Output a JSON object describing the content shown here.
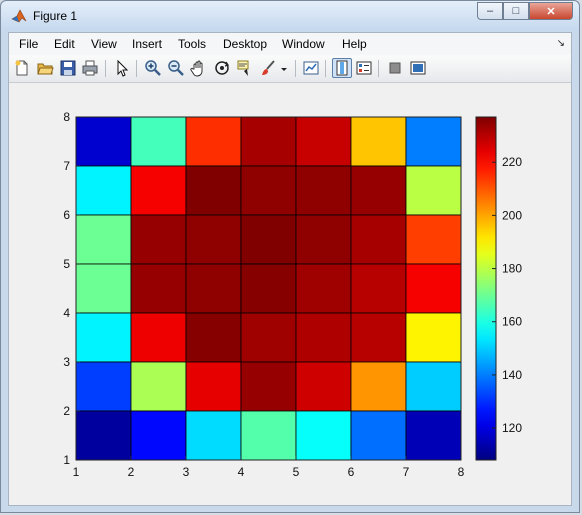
{
  "window": {
    "title": "Figure 1",
    "minimize": "–",
    "maximize": "□",
    "close": "✕"
  },
  "menu": {
    "items": [
      "File",
      "Edit",
      "View",
      "Insert",
      "Tools",
      "Desktop",
      "Window",
      "Help"
    ],
    "overflow": "↘"
  },
  "toolbar": {
    "icons": [
      "new-figure-icon",
      "open-file-icon",
      "save-icon",
      "print-icon",
      "edit-plot-arrow-icon",
      "zoom-in-icon",
      "zoom-out-icon",
      "pan-hand-icon",
      "rotate-3d-icon",
      "data-cursor-icon",
      "brush-icon",
      "brush-dropdown-icon",
      "link-plot-icon",
      "colorbar-toggle-icon",
      "legend-toggle-icon",
      "hide-plot-tools-icon",
      "show-plot-tools-icon"
    ],
    "pressed": "colorbar-toggle-icon"
  },
  "chart_data": {
    "type": "heatmap",
    "xlim": [
      1,
      8
    ],
    "ylim": [
      1,
      8
    ],
    "xticks": [
      "1",
      "2",
      "3",
      "4",
      "5",
      "6",
      "7",
      "8"
    ],
    "yticks": [
      "1",
      "2",
      "3",
      "4",
      "5",
      "6",
      "7",
      "8"
    ],
    "rows_top_to_bottom": [
      [
        118,
        165,
        215,
        232,
        228,
        196,
        140
      ],
      [
        155,
        222,
        237,
        235,
        235,
        234,
        180
      ],
      [
        170,
        234,
        235,
        237,
        235,
        232,
        213
      ],
      [
        170,
        234,
        235,
        236,
        233,
        230,
        222
      ],
      [
        155,
        223,
        236,
        233,
        231,
        230,
        190
      ],
      [
        132,
        178,
        224,
        234,
        227,
        202,
        150
      ],
      [
        112,
        125,
        152,
        167,
        157,
        138,
        115
      ]
    ],
    "colorbar": {
      "range": [
        108,
        237
      ],
      "ticks": [
        120,
        140,
        160,
        180,
        200,
        220
      ],
      "colormap": "jet"
    },
    "grid": false
  }
}
